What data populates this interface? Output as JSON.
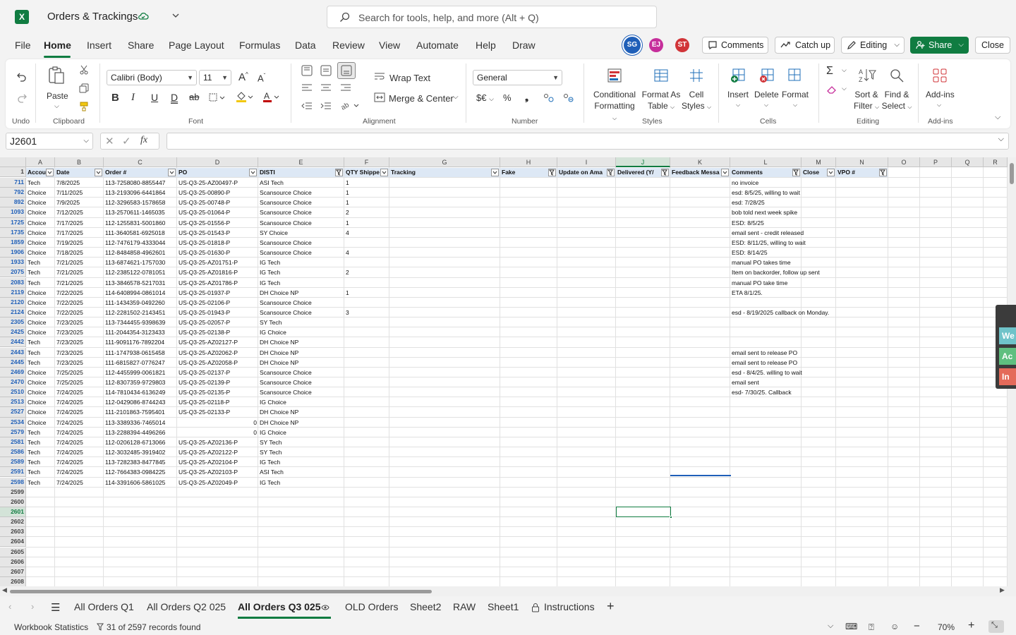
{
  "app": {
    "doc_title": "Orders & Trackings",
    "search_placeholder": "Search for tools, help, and more (Alt + Q)",
    "logo_letter": "X",
    "menu": [
      "File",
      "Home",
      "Insert",
      "Share",
      "Page Layout",
      "Formulas",
      "Data",
      "Review",
      "View",
      "Automate",
      "Help",
      "Draw"
    ],
    "avatars": [
      {
        "initials": "SG",
        "color": "#1f5fb8"
      },
      {
        "initials": "EJ",
        "color": "#c62e9b"
      },
      {
        "initials": "ST",
        "color": "#d13438"
      }
    ],
    "comments_label": "Comments",
    "catchup_label": "Catch up",
    "editing_label": "Editing",
    "share_label": "Share",
    "close_label": "Close"
  },
  "ribbon": {
    "paste_label": "Paste",
    "groups": {
      "undo": "Undo",
      "clipboard": "Clipboard",
      "font": "Font",
      "alignment": "Alignment",
      "number": "Number",
      "styles": "Styles",
      "cells": "Cells",
      "editing": "Editing",
      "addins": "Add-ins"
    },
    "font_name": "Calibri (Body)",
    "font_size": "11",
    "wrap_text": "Wrap Text",
    "merge_center": "Merge & Center",
    "number_format": "General",
    "conditional_formatting": [
      "Conditional",
      "Formatting"
    ],
    "format_as_table": [
      "Format As",
      "Table"
    ],
    "cell_styles": [
      "Cell",
      "Styles"
    ],
    "insert": "Insert",
    "delete": "Delete",
    "format": "Format",
    "sort_filter": [
      "Sort &",
      "Filter"
    ],
    "find_select": [
      "Find &",
      "Select"
    ],
    "addins": "Add-ins"
  },
  "formula_bar": {
    "name_box": "J2601",
    "formula": ""
  },
  "grid": {
    "columns": [
      "A",
      "B",
      "C",
      "D",
      "E",
      "F",
      "G",
      "H",
      "I",
      "J",
      "K",
      "L",
      "M",
      "N",
      "O",
      "P",
      "Q",
      "R"
    ],
    "selected_column": "J",
    "header_row": [
      "Accou",
      "Date",
      "Order #",
      "PO",
      "DISTI",
      "QTY Shippe",
      "Tracking",
      "Fake",
      "Update on Ama",
      "Delivered (Y/",
      "Feedback Messa",
      "Comments",
      "Close",
      "VPO #"
    ],
    "rows": [
      {
        "n": "711",
        "a": "Tech",
        "b": "7/8/2025",
        "c": "113-7258080-8855447",
        "d": "US-Q3-25-AZ00497-P",
        "e": "ASI Tech",
        "f": "1",
        "l": "no invoice"
      },
      {
        "n": "792",
        "a": "Choice",
        "b": "7/11/2025",
        "c": "113-2193096-6441864",
        "d": "US-Q3-25-00890-P",
        "e": "Scansource Choice",
        "f": "1",
        "l": "esd: 8/5/25, willing to wait"
      },
      {
        "n": "892",
        "a": "Choice",
        "b": "7/9/2025",
        "c": "112-3296583-1578658",
        "d": "US-Q3-25-00748-P",
        "e": "Scansource Choice",
        "f": "1",
        "l": "esd: 7/28/25"
      },
      {
        "n": "1093",
        "a": "Choice",
        "b": "7/12/2025",
        "c": "113-2570611-1465035",
        "d": "US-Q3-25-01064-P",
        "e": "Scansource Choice",
        "f": "2",
        "l": "bob told next week spike"
      },
      {
        "n": "1725",
        "a": "Choice",
        "b": "7/17/2025",
        "c": "112-1255831-5001860",
        "d": "US-Q3-25-01556-P",
        "e": "Scansource Choice",
        "f": "1",
        "l": " ESD:  8/5/25"
      },
      {
        "n": "1735",
        "a": "Choice",
        "b": "7/17/2025",
        "c": "111-3640581-6925018",
        "d": "US-Q3-25-01543-P",
        "e": "SY Choice",
        "f": "4",
        "l": "email sent - credit released"
      },
      {
        "n": "1859",
        "a": "Choice",
        "b": "7/19/2025",
        "c": "112-7476179-4333044",
        "d": "US-Q3-25-01818-P",
        "e": "Scansource Choice",
        "f": "",
        "l": "ESD: 8/11/25, willing to wait"
      },
      {
        "n": "1906",
        "a": "Choice",
        "b": "7/18/2025",
        "c": "112-8484858-4962601",
        "d": "US-Q3-25-01630-P",
        "e": "Scansource Choice",
        "f": "4",
        "l": "ESD: 8/14/25"
      },
      {
        "n": "1933",
        "a": "Tech",
        "b": "7/21/2025",
        "c": "113-6874621-1757030",
        "d": "US-Q3-25-AZ01751-P",
        "e": "IG Tech",
        "f": "",
        "l": "manual PO takes time"
      },
      {
        "n": "2075",
        "a": "Tech",
        "b": "7/21/2025",
        "c": "112-2385122-0781051",
        "d": "US-Q3-25-AZ01816-P",
        "e": "IG Tech",
        "f": "2",
        "l": "Item on backorder, follow up sent"
      },
      {
        "n": "2083",
        "a": "Tech",
        "b": "7/21/2025",
        "c": "113-3846578-5217031",
        "d": "US-Q3-25-AZ01786-P",
        "e": "IG Tech",
        "f": "",
        "l": "manual PO take time"
      },
      {
        "n": "2119",
        "a": "Choice",
        "b": "7/22/2025",
        "c": "114-6408994-0861014",
        "d": "US-Q3-25-01937-P",
        "e": "DH Choice NP",
        "f": "1",
        "l": "ETA 8/1/25."
      },
      {
        "n": "2120",
        "a": "Choice",
        "b": "7/22/2025",
        "c": "111-1434359-0492260",
        "d": "US-Q3-25-02106-P",
        "e": "Scansource Choice",
        "f": "",
        "l": ""
      },
      {
        "n": "2124",
        "a": "Choice",
        "b": "7/22/2025",
        "c": "112-2281502-2143451",
        "d": "US-Q3-25-01943-P",
        "e": "Scansource Choice",
        "f": "3",
        "l": "esd - 8/19/2025 callback on Monday."
      },
      {
        "n": "2305",
        "a": "Choice",
        "b": "7/23/2025",
        "c": "113-7344455-9398639",
        "d": "US-Q3-25-02057-P",
        "e": "SY Tech",
        "f": "",
        "l": ""
      },
      {
        "n": "2425",
        "a": "Choice",
        "b": "7/23/2025",
        "c": "111-2044354-3123433",
        "d": "US-Q3-25-02138-P",
        "e": "IG Choice",
        "f": "",
        "l": ""
      },
      {
        "n": "2442",
        "a": "Tech",
        "b": "7/23/2025",
        "c": "111-9091176-7892204",
        "d": "US-Q3-25-AZ02127-P",
        "e": "DH Choice NP",
        "f": "",
        "l": ""
      },
      {
        "n": "2443",
        "a": "Tech",
        "b": "7/23/2025",
        "c": "111-1747938-0615458",
        "d": "US-Q3-25-AZ02062-P",
        "e": "DH Choice NP",
        "f": "",
        "l": "email sent to release PO"
      },
      {
        "n": "2445",
        "a": "Tech",
        "b": "7/23/2025",
        "c": "111-6815827-0776247",
        "d": "US-Q3-25-AZ02058-P",
        "e": "DH Choice NP",
        "f": "",
        "l": "email sent to release PO"
      },
      {
        "n": "2469",
        "a": "Choice",
        "b": "7/25/2025",
        "c": "112-4455999-0061821",
        "d": "US-Q3-25-02137-P",
        "e": "Scansource Choice",
        "f": "",
        "l": "esd -  8/4/25. willing to wait"
      },
      {
        "n": "2470",
        "a": "Choice",
        "b": "7/25/2025",
        "c": "112-8307359-9729803",
        "d": "US-Q3-25-02139-P",
        "e": "Scansource Choice",
        "f": "",
        "l": "email sent"
      },
      {
        "n": "2510",
        "a": "Choice",
        "b": "7/24/2025",
        "c": "114-7810434-6136249",
        "d": "US-Q3-25-02135-P",
        "e": "Scansource Choice",
        "f": "",
        "l": "esd- 7/30/25. Callback"
      },
      {
        "n": "2513",
        "a": "Choice",
        "b": "7/24/2025",
        "c": "112-0429086-8744243",
        "d": "US-Q3-25-02118-P",
        "e": "IG Choice",
        "f": "",
        "l": ""
      },
      {
        "n": "2527",
        "a": "Choice",
        "b": "7/24/2025",
        "c": "111-2101863-7595401",
        "d": "US-Q3-25-02133-P",
        "e": "DH Choice NP",
        "f": "",
        "l": ""
      },
      {
        "n": "2534",
        "a": "Choice",
        "b": "7/24/2025",
        "c": "113-3389336-7465014",
        "d": "0",
        "e": "DH Choice NP",
        "f": "",
        "l": ""
      },
      {
        "n": "2579",
        "a": "Tech",
        "b": "7/24/2025",
        "c": "113-2288394-4496266",
        "d": "0",
        "e": "IG Choice",
        "f": "",
        "l": ""
      },
      {
        "n": "2581",
        "a": "Tech",
        "b": "7/24/2025",
        "c": "112-0206128-6713066",
        "d": "US-Q3-25-AZ02136-P",
        "e": "SY Tech",
        "f": "",
        "l": ""
      },
      {
        "n": "2586",
        "a": "Tech",
        "b": "7/24/2025",
        "c": "112-3032485-3919402",
        "d": "US-Q3-25-AZ02122-P",
        "e": "SY Tech",
        "f": "",
        "l": ""
      },
      {
        "n": "2589",
        "a": "Tech",
        "b": "7/24/2025",
        "c": "113-7282383-8477845",
        "d": "US-Q3-25-AZ02104-P",
        "e": "IG Tech",
        "f": "",
        "l": ""
      },
      {
        "n": "2591",
        "a": "Tech",
        "b": "7/24/2025",
        "c": "112-7664383-0984225",
        "d": "US-Q3-25-AZ02103-P",
        "e": "ASI Tech",
        "f": "",
        "l": ""
      },
      {
        "n": "2598",
        "a": "Tech",
        "b": "7/24/2025",
        "c": "114-3391606-5861025",
        "d": "US-Q3-25-AZ02049-P",
        "e": "IG Tech",
        "f": "",
        "l": ""
      }
    ],
    "empty_rows": [
      "2599",
      "2600",
      "2601",
      "2602",
      "2603",
      "2604",
      "2605",
      "2606",
      "2607",
      "2608"
    ],
    "selected_row": "2601"
  },
  "side_widget": [
    "We",
    "Ac",
    "In"
  ],
  "sheet_tabs": [
    "All Orders Q1",
    "All Orders Q2 025",
    "All Orders Q3 025",
    "OLD Orders",
    "Sheet2",
    "RAW",
    "Sheet1",
    "Instructions"
  ],
  "active_tab": "All Orders Q3 025",
  "status": {
    "workbook_stats": "Workbook Statistics",
    "records": "31 of 2597 records found",
    "zoom": "70%"
  }
}
